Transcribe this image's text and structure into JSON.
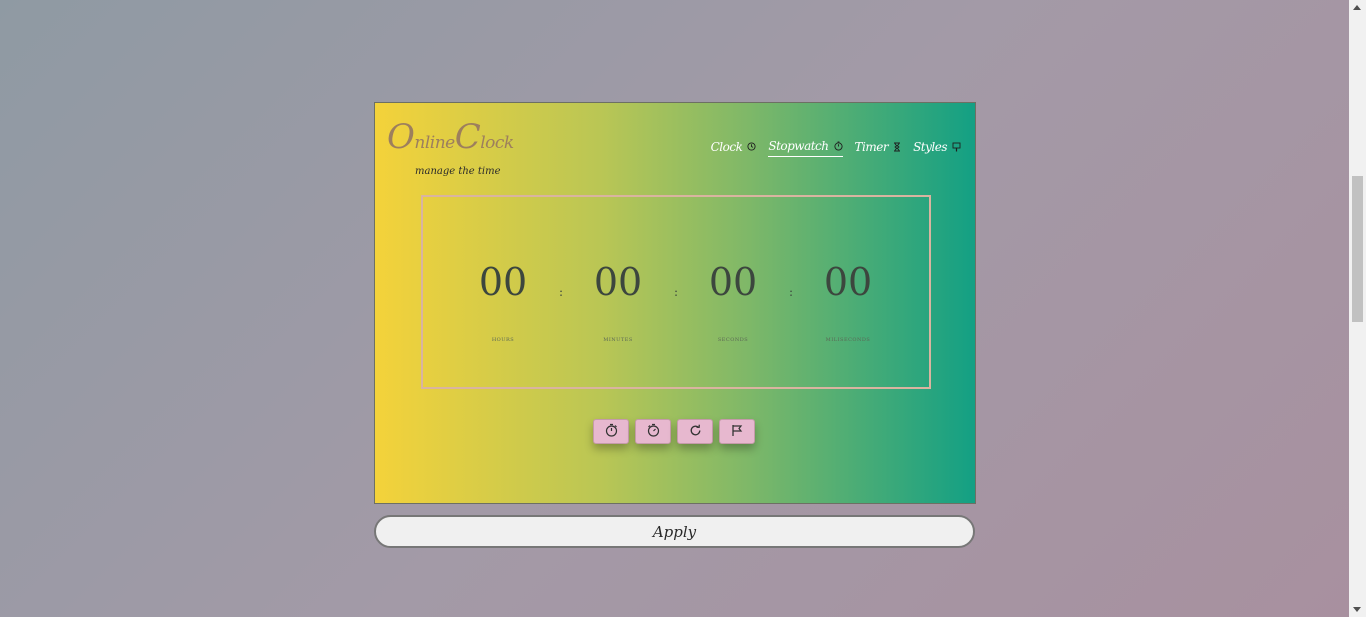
{
  "logo": {
    "first_initial": "O",
    "first_rest": "nline",
    "second_initial": "C",
    "second_rest": "lock",
    "tagline": "manage the time"
  },
  "nav": {
    "items": [
      {
        "label": "Clock",
        "icon": "clock-icon"
      },
      {
        "label": "Stopwatch",
        "icon": "stopwatch-icon"
      },
      {
        "label": "Timer",
        "icon": "hourglass-icon"
      },
      {
        "label": "Styles",
        "icon": "brush-icon"
      }
    ],
    "active": "Stopwatch"
  },
  "stopwatch": {
    "hours": {
      "value": "00",
      "label": "HOURS"
    },
    "minutes": {
      "value": "00",
      "label": "MINUTES"
    },
    "seconds": {
      "value": "00",
      "label": "SECONDS"
    },
    "milliseconds": {
      "value": "00",
      "label": "MILISECONDS"
    },
    "separator": ":"
  },
  "controls": [
    {
      "name": "start",
      "icon": "stopwatch-start-icon"
    },
    {
      "name": "pause",
      "icon": "stopwatch-pause-icon"
    },
    {
      "name": "reset",
      "icon": "reset-icon"
    },
    {
      "name": "lap",
      "icon": "flag-icon"
    }
  ],
  "apply_label": "Apply",
  "colors": {
    "gradient_start": "#f4d23a",
    "gradient_end": "#13a084",
    "button_bg": "#e7b8cf",
    "display_border": "#d9b4a0"
  }
}
